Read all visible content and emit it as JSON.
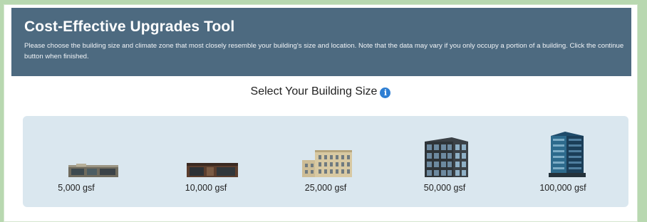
{
  "header": {
    "title": "Cost-Effective Upgrades Tool",
    "description": "Please choose the building size and climate zone that most closely resemble your building's size and location. Note that the data may vary if you only occupy a portion of a building. Click the continue button when finished."
  },
  "section": {
    "title": "Select Your Building Size",
    "info_icon": "info-icon"
  },
  "buildings": [
    {
      "label": "5,000 gsf",
      "icon": "small-commercial-building-icon"
    },
    {
      "label": "10,000 gsf",
      "icon": "brick-building-icon"
    },
    {
      "label": "25,000 gsf",
      "icon": "mid-rise-building-icon"
    },
    {
      "label": "50,000 gsf",
      "icon": "glass-tower-icon"
    },
    {
      "label": "100,000 gsf",
      "icon": "high-rise-tower-icon"
    }
  ],
  "colors": {
    "header_bg": "#4d6a80",
    "options_bg": "#dae7ef",
    "info_icon": "#2f7fd3"
  }
}
